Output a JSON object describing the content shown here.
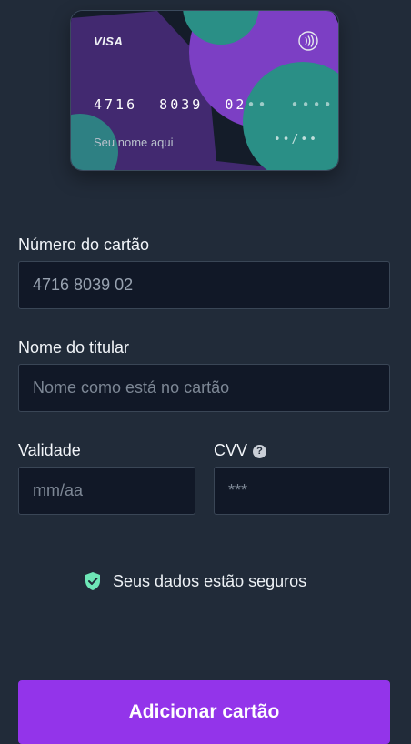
{
  "card_preview": {
    "brand": "VISA",
    "number_entered": "4716  8039  02",
    "number_masked": "••  ••••",
    "holder_placeholder": "Seu nome aqui",
    "expiry_placeholder": "••/••",
    "contactless_icon": "contactless-icon",
    "colors": {
      "base": "#141c29",
      "purple": "#7c3fc4",
      "teal": "#2a8f86",
      "deep_purple": "#4a2b7c"
    }
  },
  "form": {
    "card_number": {
      "label": "Número do cartão",
      "value": "4716 8039 02"
    },
    "holder_name": {
      "label": "Nome do titular",
      "placeholder": "Nome como está no cartão"
    },
    "expiry": {
      "label": "Validade",
      "placeholder": "mm/aa"
    },
    "cvv": {
      "label": "CVV",
      "placeholder": "***",
      "help_icon": "?"
    }
  },
  "security_note": {
    "icon": "shield-check-icon",
    "text": "Seus dados estão seguros",
    "icon_color": "#6ee7b7"
  },
  "submit_button": {
    "label": "Adicionar cartão",
    "color": "#9334ea"
  }
}
